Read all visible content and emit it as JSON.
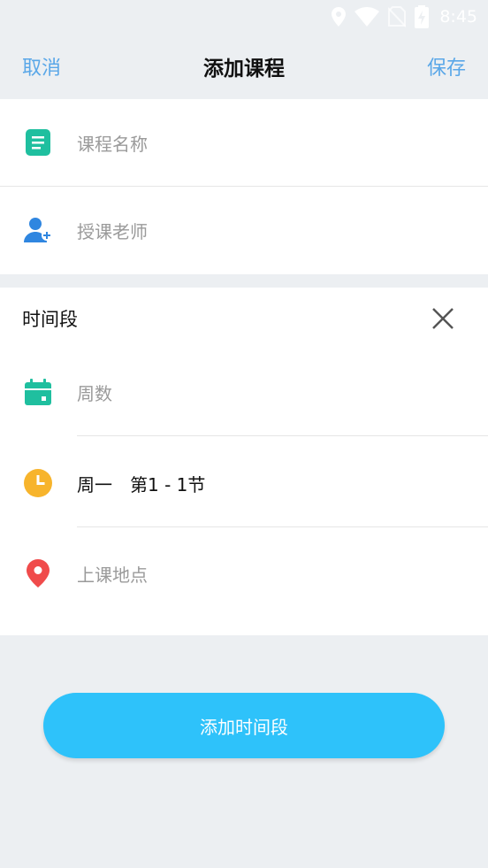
{
  "status_bar": {
    "time": "8:45",
    "icons": [
      "location-icon",
      "wifi-icon",
      "no-sim-icon",
      "battery-charging-icon"
    ]
  },
  "header": {
    "cancel_label": "取消",
    "title": "添加课程",
    "save_label": "保存"
  },
  "course_info": {
    "name_placeholder": "课程名称",
    "teacher_placeholder": "授课老师"
  },
  "time_section": {
    "title": "时间段",
    "weeks_placeholder": "周数",
    "schedule_value": "周一　第1 - 1节",
    "location_placeholder": "上课地点"
  },
  "actions": {
    "add_time_label": "添加时间段"
  },
  "colors": {
    "accent_blue": "#5aa7e8",
    "button_blue": "#2ec2fa",
    "teal_icon": "#1fbf9f",
    "user_icon": "#2f86e0",
    "clock_icon": "#f7b42c",
    "location_icon": "#f04b4b",
    "background": "#eceff2"
  }
}
